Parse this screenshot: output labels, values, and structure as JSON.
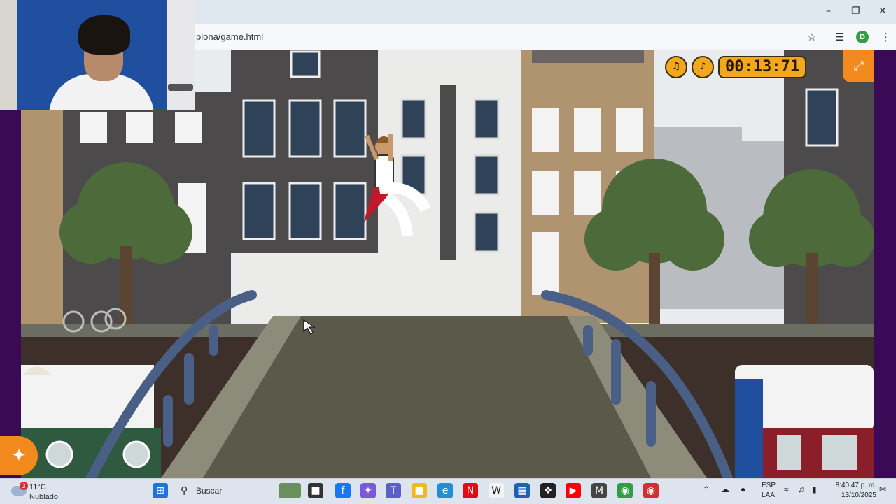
{
  "browser": {
    "url": "plona/game.html",
    "profile_initial": "D"
  },
  "game": {
    "timer": "00:13:71",
    "hud_icons": [
      "sound-icon",
      "music-icon"
    ],
    "fullscreen_icon": "expand-icon",
    "scene": {
      "sky": "#e8ecef",
      "bridge_color": "#4a5f86",
      "deck_color": "#5b5a4a",
      "building_dark": "#4d4a4c",
      "building_white": "#ebebea",
      "building_tan": "#b0946f",
      "tree_color": "#4d6b3a",
      "water_color": "#3d2f2a"
    },
    "player": {
      "outfit": "white with red sash"
    }
  },
  "taskbar": {
    "weather": {
      "temp": "11°C",
      "condition": "Nublado",
      "badge": "3"
    },
    "search_label": "Buscar",
    "language": "ESP",
    "layout": "LAA",
    "time": "8:40:47 p. m.",
    "date": "13/10/2025"
  }
}
